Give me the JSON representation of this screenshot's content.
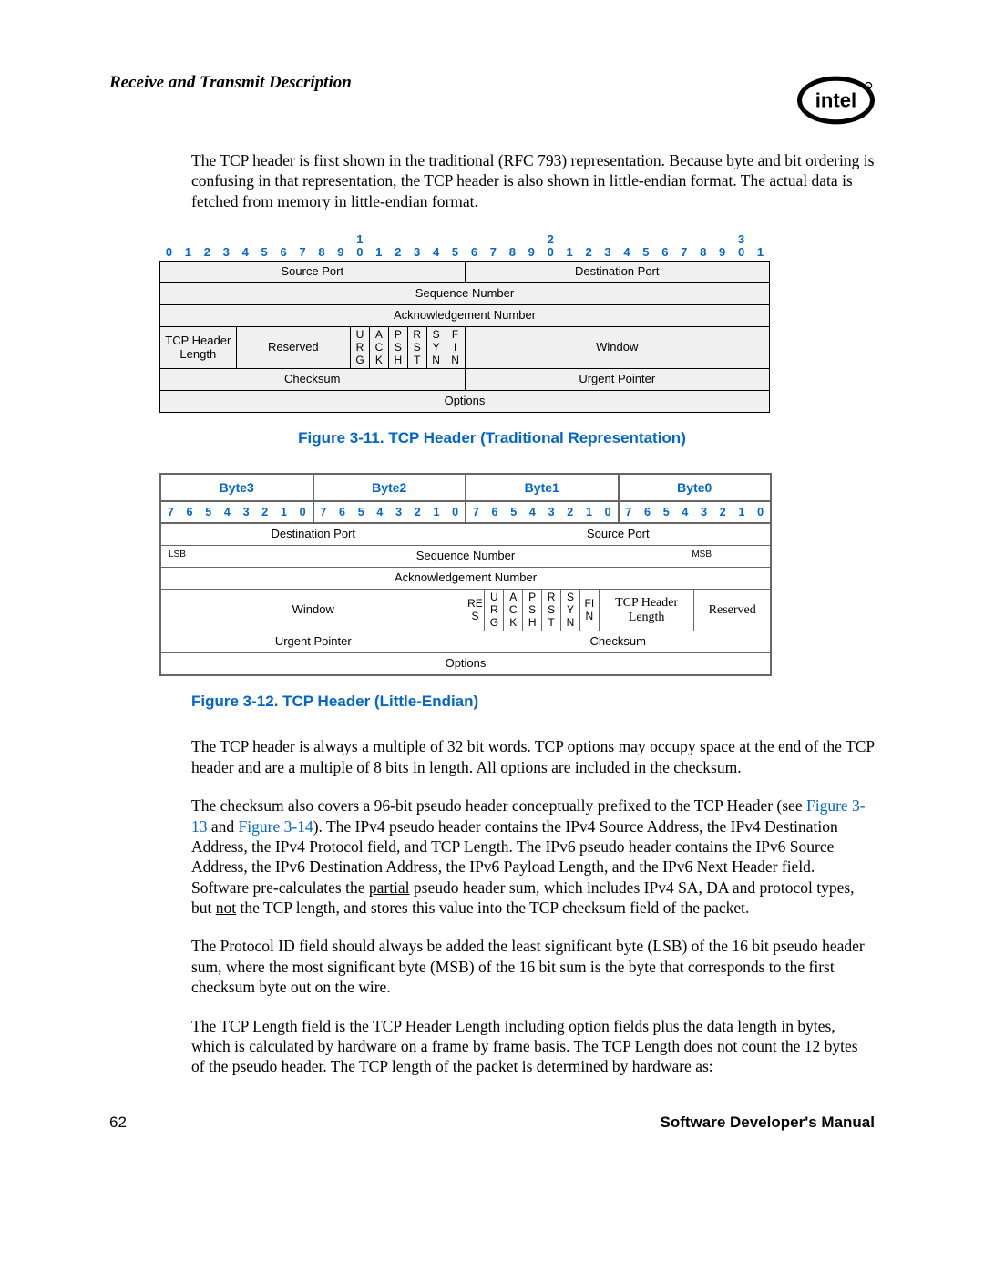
{
  "header": {
    "title": "Receive and Transmit Description",
    "logo_label": "intel"
  },
  "intro_text": "The TCP header is first shown in the traditional (RFC 793) representation. Because byte and bit ordering is confusing in that representation, the TCP header is also shown in little-endian format. The actual data is fetched from memory in little-endian format.",
  "fig1": {
    "caption": "Figure 3-11. TCP Header (Traditional Representation)",
    "bit_top_marks": {
      "10": "1",
      "20": "2",
      "30": "3"
    },
    "bits": [
      "0",
      "1",
      "2",
      "3",
      "4",
      "5",
      "6",
      "7",
      "8",
      "9",
      "0",
      "1",
      "2",
      "3",
      "4",
      "5",
      "6",
      "7",
      "8",
      "9",
      "0",
      "1",
      "2",
      "3",
      "4",
      "5",
      "6",
      "7",
      "8",
      "9",
      "0",
      "1"
    ],
    "rows": {
      "source_port": "Source Port",
      "dest_port": "Destination Port",
      "seq_num": "Sequence Number",
      "ack_num": "Acknowledgement Number",
      "hdr_len": "TCP Header Length",
      "reserved": "Reserved",
      "flags": [
        "U\nR\nG",
        "A\nC\nK",
        "P\nS\nH",
        "R\nS\nT",
        "S\nY\nN",
        "F\nI\nN"
      ],
      "window": "Window",
      "checksum": "Checksum",
      "urgent": "Urgent Pointer",
      "options": "Options"
    }
  },
  "fig2": {
    "caption": "Figure 3-12. TCP Header (Little-Endian)",
    "byte_headers": [
      "Byte3",
      "Byte2",
      "Byte1",
      "Byte0"
    ],
    "bits_per_byte": [
      "7",
      "6",
      "5",
      "4",
      "3",
      "2",
      "1",
      "0"
    ],
    "rows": {
      "dest_port": "Destination Port",
      "source_port": "Source Port",
      "seq_num": "Sequence Number",
      "lsb": "LSB",
      "msb": "MSB",
      "ack_num": "Acknowledgement Number",
      "window": "Window",
      "res": "RE\nS",
      "flags": [
        "U\nR\nG",
        "A\nC\nK",
        "P\nS\nH",
        "R\nS\nT",
        "S\nY\nN",
        "FI\nN"
      ],
      "hdr_len": "TCP Header Length",
      "reserved": "Reserved",
      "urgent": "Urgent Pointer",
      "checksum": "Checksum",
      "options": "Options"
    }
  },
  "para1": "The TCP header is always a multiple of 32 bit words. TCP options may occupy space at the end of the TCP header and are a multiple of 8 bits in length. All options are included in the checksum.",
  "para2_pre": "The checksum also covers a 96-bit pseudo header conceptually prefixed to the TCP Header (see ",
  "para2_link1": "Figure 3-13",
  "para2_mid": " and ",
  "para2_link2": "Figure 3-14",
  "para2_post1": "). The IPv4 pseudo header contains the IPv4 Source Address, the IPv4 Destination Address, the IPv4 Protocol field, and TCP Length. The IPv6 pseudo header contains the IPv6 Source Address, the IPv6 Destination Address, the IPv6 Payload Length, and the IPv6 Next Header field. Software pre-calculates the ",
  "para2_under1": "partial",
  "para2_post2": " pseudo header sum, which includes IPv4 SA, DA and protocol types, but ",
  "para2_under2": "not",
  "para2_post3": " the TCP length, and stores this value into the TCP checksum field of the packet.",
  "para3": "The Protocol ID field should always be added the least significant byte (LSB) of the 16 bit pseudo header sum, where the most significant byte (MSB) of the 16 bit sum is the byte that corresponds to the first checksum byte out on the wire.",
  "para4": "The TCP Length field is the TCP Header Length including option fields plus the data length in bytes, which is calculated by hardware on a frame by frame basis. The TCP Length does not count the 12 bytes of the pseudo header. The TCP length of the packet is determined by hardware as:",
  "footer": {
    "page": "62",
    "manual": "Software Developer's Manual"
  }
}
